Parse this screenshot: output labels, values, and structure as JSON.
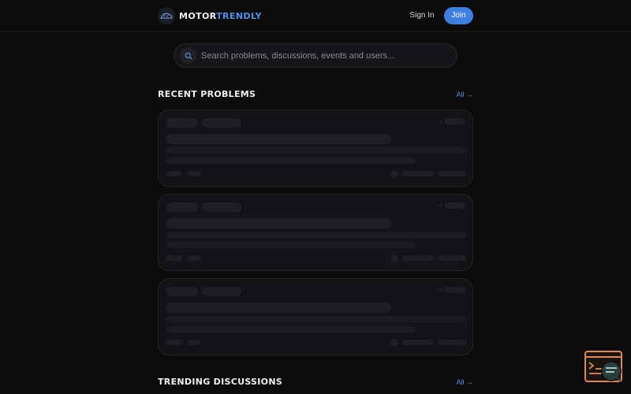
{
  "header": {
    "logo_part1": "MOTOR",
    "logo_part2": "TRENDLY",
    "sign_in_label": "Sign In",
    "join_label": "Join"
  },
  "search": {
    "placeholder": "Search problems, discussions, events and users..."
  },
  "sections": {
    "recent_problems": {
      "title": "RECENT PROBLEMS",
      "all_label": "All →"
    },
    "trending_discussions": {
      "title": "TRENDING DISCUSSIONS",
      "all_label": "All →"
    }
  },
  "colors": {
    "background": "#0c0c0d",
    "accent": "#3d7fe0",
    "card": "#141416",
    "skeleton": "#1f1f22",
    "fab_orange": "#e0894a"
  },
  "icons": {
    "logo": "car-logo-icon",
    "search": "search-icon",
    "fab": "code-chat-icon"
  }
}
